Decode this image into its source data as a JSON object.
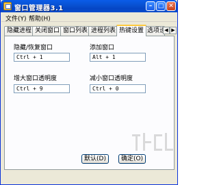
{
  "window": {
    "title": "窗口管理器3.1",
    "controls": {
      "minimize": "–",
      "maximize": "□",
      "close": "✕"
    }
  },
  "menu": {
    "file": "文件(Y)",
    "help": "帮助(H)"
  },
  "tabs": [
    {
      "label": "隐藏进程"
    },
    {
      "label": "关闭窗口"
    },
    {
      "label": "窗口列表"
    },
    {
      "label": "进程列表"
    },
    {
      "label": "热键设置",
      "active": true
    },
    {
      "label": "选项设置"
    }
  ],
  "tab_scroll": {
    "left": "◀",
    "right": "▶"
  },
  "hotkeys": {
    "hide_restore": {
      "label": "隐藏/恢复窗口",
      "value": "Ctrl + 1"
    },
    "add_window": {
      "label": "添加窗口",
      "value": "Alt + 1"
    },
    "increase_opacity": {
      "label": "增大窗口透明度",
      "value": "Ctrl + 9"
    },
    "decrease_opacity": {
      "label": "减小窗口透明度",
      "value": "Ctrl + 0"
    }
  },
  "buttons": {
    "default": "默认(D)",
    "ok": "确定(O)"
  }
}
